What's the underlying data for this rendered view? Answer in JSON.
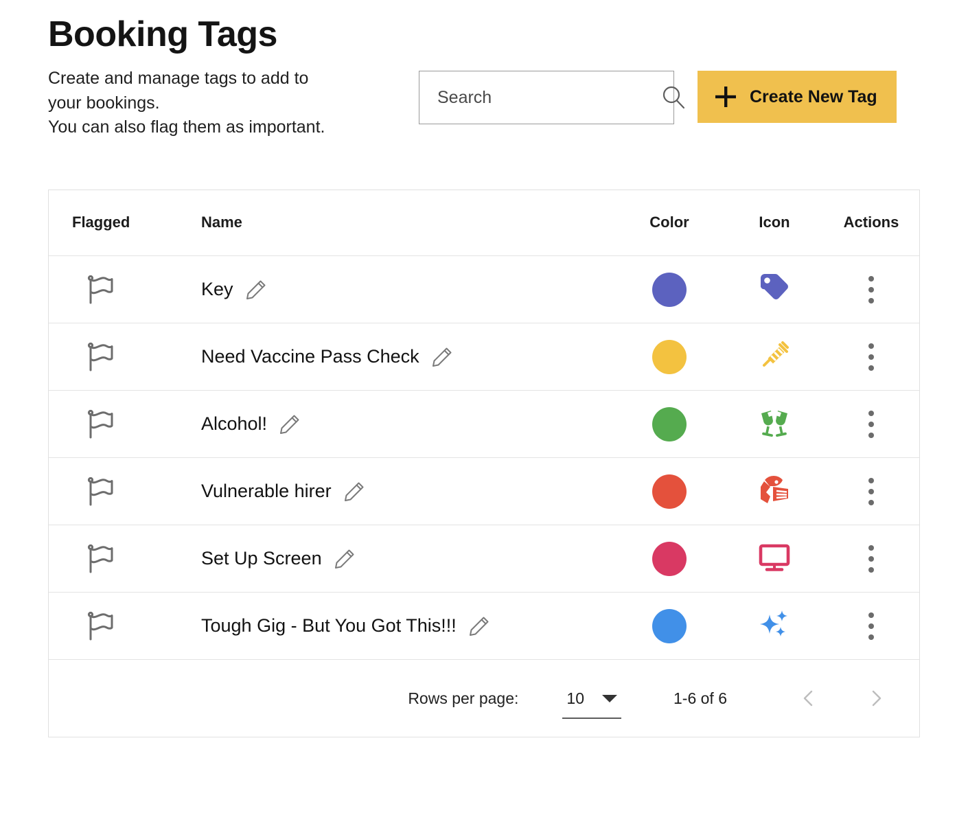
{
  "header": {
    "title": "Booking Tags",
    "subtitle_lines": [
      "Create and manage tags to add to",
      "your bookings.",
      "You can also flag them as important."
    ],
    "search": {
      "value": "",
      "placeholder": "Search",
      "icon": "search-icon"
    },
    "create_button": {
      "label": "Create New Tag",
      "icon": "plus-icon",
      "background": "#f0c04e"
    }
  },
  "table": {
    "columns": [
      {
        "key": "flagged",
        "label": "Flagged"
      },
      {
        "key": "name",
        "label": "Name"
      },
      {
        "key": "color",
        "label": "Color"
      },
      {
        "key": "icon",
        "label": "Icon"
      },
      {
        "key": "actions",
        "label": "Actions"
      }
    ],
    "rows": [
      {
        "flagged": false,
        "flag_icon": "flag-outline-icon",
        "name": "Key",
        "edit_icon": "pencil-icon",
        "color": "#5c62bf",
        "icon": "tag-icon",
        "actions_icon": "more-vertical-icon"
      },
      {
        "flagged": false,
        "flag_icon": "flag-outline-icon",
        "name": "Need Vaccine Pass Check",
        "edit_icon": "pencil-icon",
        "color": "#f3c240",
        "icon": "syringe-icon",
        "actions_icon": "more-vertical-icon"
      },
      {
        "flagged": false,
        "flag_icon": "flag-outline-icon",
        "name": "Alcohol!",
        "edit_icon": "pencil-icon",
        "color": "#55ab4f",
        "icon": "champagne-glasses-icon",
        "actions_icon": "more-vertical-icon"
      },
      {
        "flagged": false,
        "flag_icon": "flag-outline-icon",
        "name": "Vulnerable hirer",
        "edit_icon": "pencil-icon",
        "color": "#e4513c",
        "icon": "face-mask-icon",
        "actions_icon": "more-vertical-icon"
      },
      {
        "flagged": false,
        "flag_icon": "flag-outline-icon",
        "name": "Set Up Screen",
        "edit_icon": "pencil-icon",
        "color": "#d93963",
        "icon": "monitor-icon",
        "actions_icon": "more-vertical-icon"
      },
      {
        "flagged": false,
        "flag_icon": "flag-outline-icon",
        "name": "Tough Gig - But You Got This!!!",
        "edit_icon": "pencil-icon",
        "color": "#4190e8",
        "icon": "sparkles-icon",
        "actions_icon": "more-vertical-icon"
      }
    ]
  },
  "paginator": {
    "rows_per_page_label": "Rows per page:",
    "rows_per_page_value": "10",
    "range_label": "1-6 of 6",
    "previous_icon": "chevron-left-icon",
    "next_icon": "chevron-right-icon"
  }
}
